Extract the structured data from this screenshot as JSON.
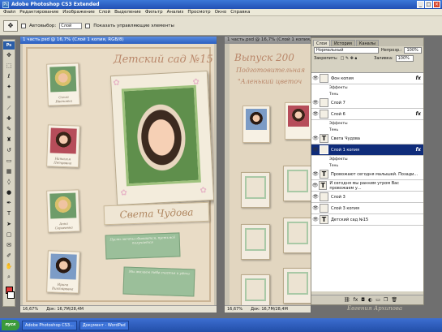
{
  "app": {
    "title": "Adobe Photoshop CS3 Extended"
  },
  "menu": [
    "Файл",
    "Редактирование",
    "Изображение",
    "Слой",
    "Выделение",
    "Фильтр",
    "Анализ",
    "Просмотр",
    "Окно",
    "Справка"
  ],
  "options": {
    "autoselect_label": "Автовыбор:",
    "autoselect_value": "Слой",
    "show_controls_label": "Показать управляющие элементы"
  },
  "doc1": {
    "tab": "1 часть.psd @ 16,7% (Слой 1 копия, RGB/8)",
    "heading": "Детский сад №15",
    "name_label": "Света Чудова",
    "captions": [
      "Ольга Ивановна",
      "Наталья Петровна",
      "Анна Сергеевна",
      "Ирина Викторовна"
    ],
    "note1": "Пусть мечты сбываются, пусть всё получается",
    "note2": "Мы желаем тебе счастья и удачи",
    "zoom": "16,67%",
    "docsize": "Док: 16,7M/28,4M"
  },
  "doc2": {
    "tab": "1 часть.psd @ 16,7% (Слой 1 копия, RGB/8)",
    "heading1": "Выпуск 200",
    "heading2": "Подготовительная",
    "heading3": "\"Аленький цветоч",
    "zoom": "16,67%",
    "docsize": "Док: 16,7M/28,4M"
  },
  "panel": {
    "tabs": [
      "Слои",
      "История",
      "Каналы"
    ],
    "blend_mode": "Нормальный",
    "opacity_label": "Непрозр.:",
    "opacity_value": "100%",
    "lock_label": "Закрепить:",
    "fill_label": "Заливка:",
    "fill_value": "100%",
    "layers": [
      {
        "name": "Фон копия",
        "fx": true
      },
      {
        "name": "Эффекты",
        "sub": true
      },
      {
        "name": "Тень",
        "sub": true
      },
      {
        "name": "Слой 7"
      },
      {
        "name": "Слой 6",
        "fx": true
      },
      {
        "name": "Эффекты",
        "sub": true
      },
      {
        "name": "Тень",
        "sub": true
      },
      {
        "name": "Света Чудова",
        "text": true
      },
      {
        "name": "Слой 1 копия",
        "fx": true,
        "selected": true
      },
      {
        "name": "Эффекты",
        "sub": true
      },
      {
        "name": "Тень",
        "sub": true
      },
      {
        "name": "Провожают сегодня малышей. Позади...",
        "text": true
      },
      {
        "name": "И сегодня мы ранним утром Вас провожаем у...",
        "text": true
      },
      {
        "name": "Слой 3"
      },
      {
        "name": "Слой 3 копия"
      },
      {
        "name": "Детский сад №15",
        "text": true
      }
    ]
  },
  "watermark": "Евгения Архипова",
  "taskbar": {
    "start": "пуск",
    "tasks": [
      "Adobe Photoshop CS3...",
      "Документ - WordPad"
    ]
  }
}
